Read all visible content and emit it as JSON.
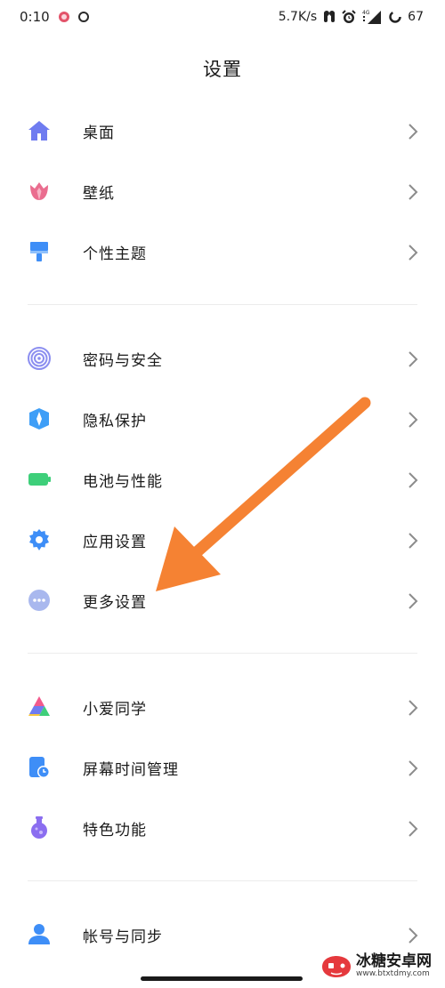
{
  "status_bar": {
    "time": "0:10",
    "network_speed": "5.7K/s",
    "network_type": "4G",
    "battery": "67",
    "icons": [
      "notification-red-icon",
      "notification-ring-icon",
      "earbuds-icon",
      "alarm-icon",
      "signal-icon",
      "battery-ring-icon"
    ]
  },
  "header": {
    "title": "设置"
  },
  "colors": {
    "accent_blue": "#3e8ef7",
    "annotation_orange": "#f58233",
    "chevron": "#8c8c8c",
    "divider": "#ececec"
  },
  "groups": [
    {
      "items": [
        {
          "label": "桌面",
          "icon": "home-icon"
        },
        {
          "label": "壁纸",
          "icon": "tulip-icon"
        },
        {
          "label": "个性主题",
          "icon": "paintbrush-icon"
        }
      ]
    },
    {
      "items": [
        {
          "label": "密码与安全",
          "icon": "fingerprint-icon"
        },
        {
          "label": "隐私保护",
          "icon": "privacy-shield-icon"
        },
        {
          "label": "电池与性能",
          "icon": "battery-icon"
        },
        {
          "label": "应用设置",
          "icon": "gear-icon"
        },
        {
          "label": "更多设置",
          "icon": "more-dots-icon"
        }
      ]
    },
    {
      "items": [
        {
          "label": "小爱同学",
          "icon": "xiaoai-icon"
        },
        {
          "label": "屏幕时间管理",
          "icon": "screen-time-icon"
        },
        {
          "label": "特色功能",
          "icon": "flask-icon"
        }
      ]
    },
    {
      "items": [
        {
          "label": "帐号与同步",
          "icon": "account-icon"
        }
      ]
    }
  ],
  "watermark": {
    "title": "冰糖安卓网",
    "url": "www.btxtdmy.com"
  }
}
